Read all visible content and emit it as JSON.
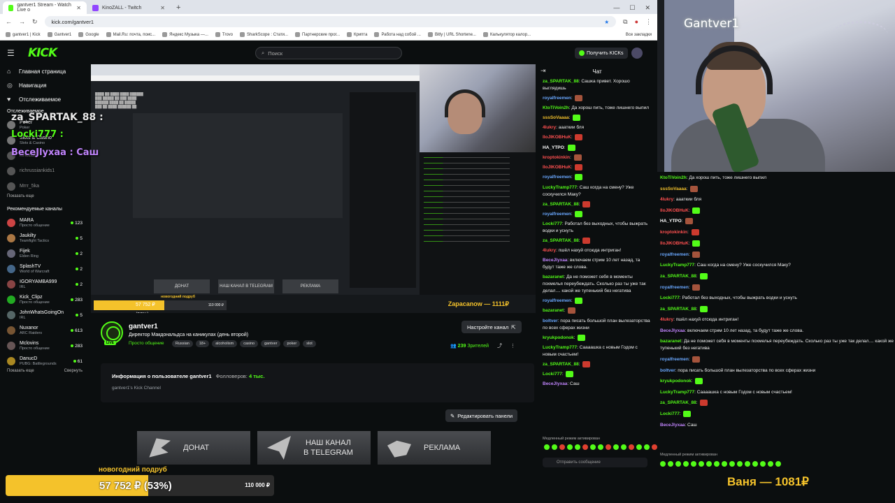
{
  "browser": {
    "tabs": [
      {
        "title": "gantver1 Stream - Watch Live o",
        "active": true,
        "color": "#53fc18"
      },
      {
        "title": "KinoZALL - Twitch",
        "active": false,
        "color": "#9146ff"
      }
    ],
    "url": "kick.com/gantver1",
    "bookmarks": [
      "gantver1 | Kick",
      "Gantver1",
      "Google",
      "Mail.Ru: почта, поис...",
      "Яндекс Музыка —...",
      "Trovo",
      "SharkScope : Стати...",
      "Партнерские прог...",
      "Крипта",
      "Работа над собой ...",
      "Bitly | URL Shortene...",
      "Калькулятор калор..."
    ],
    "all_bookmarks": "Все закладки"
  },
  "kick": {
    "logo": "KICK",
    "search_placeholder": "Поиск",
    "get_kicks": "Получить KICKs",
    "nav": {
      "home": "Главная страница",
      "browse": "Навигация",
      "following": "Отслеживаемое"
    },
    "following_title": "Отслеживаемое",
    "following": [
      {
        "name": "Poker",
        "game": "Poker",
        "dim": false
      },
      {
        "name": "Slots & Casino",
        "game": "Slots & Casino",
        "dim": false
      },
      {
        "name": "kinozall",
        "game": "",
        "dim": true
      },
      {
        "name": "richrussiankids1",
        "game": "",
        "dim": true
      },
      {
        "name": "Mrrr_5ka",
        "game": "",
        "dim": true
      }
    ],
    "show_more": "Показать еще",
    "recommended_title": "Рекомендуемые каналы",
    "recommended": [
      {
        "name": "MARA",
        "game": "Просто общение",
        "count": "123",
        "color": "#c44"
      },
      {
        "name": "Jaukilty",
        "game": "Teamfight Tactics",
        "count": "5",
        "color": "#a74"
      },
      {
        "name": "Fijek",
        "game": "Elden Ring",
        "count": "2",
        "color": "#667"
      },
      {
        "name": "SplashTV",
        "game": "World of Warcraft",
        "count": "2",
        "color": "#468"
      },
      {
        "name": "IGORYAMBA999",
        "game": "IRL",
        "count": "2",
        "color": "#844"
      },
      {
        "name": "Kick_Clipz",
        "game": "Просто общение",
        "count": "283",
        "color": "#2a2"
      },
      {
        "name": "JohnWhatsGoingOn",
        "game": "IRL",
        "count": "5",
        "color": "#566"
      },
      {
        "name": "Nuxanor",
        "game": "ARC Raiders",
        "count": "613",
        "color": "#753"
      },
      {
        "name": "Mclovins",
        "game": "Просто общение",
        "count": "283",
        "color": "#655"
      },
      {
        "name": "DanucD",
        "game": "PUBG: Battlegrounds",
        "count": "61",
        "color": "#a82"
      }
    ],
    "show_more_2": "Показать еще",
    "collapse": "Свернуть"
  },
  "overlay_names": [
    {
      "text": "za_SPARTAK_88 :",
      "color": "#ffffff"
    },
    {
      "text": "Locki777 :",
      "color": "#53fc18"
    },
    {
      "text": "BeceJlyxaa : Саш",
      "color": "#c084fc"
    }
  ],
  "video": {
    "sub_label": "новогодний подруб",
    "bar_text": "57 752 ₽ (53%)",
    "bar_max": "110 000 ₽",
    "top_donor": "Zapacanow — 1111₽",
    "panels": [
      "ДОНАТ",
      "НАШ КАНАЛ В TELEGRAM",
      "РЕКЛАМА"
    ]
  },
  "channel": {
    "name": "gantver1",
    "live": "LIVE",
    "title": "Директор Макдональдса на каникулах (день второй)",
    "category": "Просто общение",
    "tags": [
      "Russian",
      "18+",
      "alcoholism",
      "casino",
      "gantver",
      "poker",
      "slot"
    ],
    "customize": "Настройте канал",
    "viewers": "239",
    "viewers_label": "Зрителей"
  },
  "about": {
    "heading": "Информация о пользователе gantver1",
    "followers_label": "Фолловеров:",
    "followers": "4 тыс.",
    "desc": "gantver1's Kick Channel",
    "edit_panels": "Редактировать панели"
  },
  "panels": [
    {
      "label": "ДОНАТ",
      "pic": "wing"
    },
    {
      "label": "НАШ КАНАЛ\nВ TELEGRAM",
      "pic": "plane"
    },
    {
      "label": "РЕКЛАМА",
      "pic": "hand"
    }
  ],
  "chat": {
    "title": "Чат",
    "messages": [
      {
        "user": "za_SPARTAK_88",
        "color": "#53fc18",
        "text": "Сашка привет. Хорошо выглядишь"
      },
      {
        "user": "royalfreemen",
        "color": "#6aa8ff",
        "text": ""
      },
      {
        "user": "KtoTiVoin2h",
        "color": "#53fc18",
        "text": "Да хорош пить, тоже лишнего выпил"
      },
      {
        "user": "sssSoVaaaa",
        "color": "#f4c22b",
        "text": ""
      },
      {
        "user": "4lukry",
        "color": "#ff5050",
        "text": "аааткии бля"
      },
      {
        "user": "lloJIKOBHuK",
        "color": "#ff5050",
        "text": ""
      },
      {
        "user": "HA_YTPO",
        "color": "#ffffff",
        "text": ""
      },
      {
        "user": "kroptokinkin",
        "color": "#ff5050",
        "text": ""
      },
      {
        "user": "lloJIKOBHuK",
        "color": "#ff5050",
        "text": ""
      },
      {
        "user": "royalfreemen",
        "color": "#6aa8ff",
        "text": ""
      },
      {
        "user": "LuckyTramp777",
        "color": "#53fc18",
        "text": "Саш когда на смену? Уже соскучился Маку?"
      },
      {
        "user": "za_SPARTAK_88",
        "color": "#53fc18",
        "text": ""
      },
      {
        "user": "royalfreemen",
        "color": "#6aa8ff",
        "text": ""
      },
      {
        "user": "Locki777",
        "color": "#53fc18",
        "text": "Работал без выходных, чтобы выжрать водки и уснуть"
      },
      {
        "user": "za_SPARTAK_88",
        "color": "#53fc18",
        "text": ""
      },
      {
        "user": "4lukry",
        "color": "#ff5050",
        "text": "пшёл нахуй отсюда интриган!"
      },
      {
        "user": "BeceJlyxaa",
        "color": "#c084fc",
        "text": "включаем стрим 10 лет назад, та будут таже же слова."
      },
      {
        "user": "bazaranet",
        "color": "#53fc18",
        "text": "Да не поможет себя в моменты похмелья переубеждать. Сколько раз ты уже так делал.... какой же тупенький без негатива"
      },
      {
        "user": "royalfreemen",
        "color": "#6aa8ff",
        "text": ""
      },
      {
        "user": "bazaranet",
        "color": "#53fc18",
        "text": ""
      },
      {
        "user": "boltver",
        "color": "#6aa8ff",
        "text": "пора писать большой план вылезаторства по всех сферах жизни"
      },
      {
        "user": "kryukpodonok",
        "color": "#53fc18",
        "text": ""
      },
      {
        "user": "LuckyTramp777",
        "color": "#53fc18",
        "text": "Саааашка с новым Годом с новым счастьем!"
      },
      {
        "user": "za_SPARTAK_88",
        "color": "#53fc18",
        "text": ""
      },
      {
        "user": "Locki777",
        "color": "#53fc18",
        "text": ""
      },
      {
        "user": "BeceJlyxaa",
        "color": "#c084fc",
        "text": "Саш"
      }
    ],
    "slow_mode": "Медленный режим активирован",
    "input_placeholder": "Отправить сообщение"
  },
  "cam": {
    "label": "Gantver1"
  },
  "overlay_chat": [
    {
      "user": "KtoTiVoin2h",
      "color": "#53fc18",
      "text": "Да хорош пить, тоже лишнего выпил"
    },
    {
      "user": "sssSoVaaaa",
      "color": "#f4c22b",
      "text": ""
    },
    {
      "user": "4lukry",
      "color": "#ff5050",
      "text": "аааткии бля"
    },
    {
      "user": "lloJIKOBHuK",
      "color": "#ff5050",
      "text": ""
    },
    {
      "user": "HA_YTPO",
      "color": "#ffffff",
      "text": ""
    },
    {
      "user": "kroptokinkin",
      "color": "#ff5050",
      "text": ""
    },
    {
      "user": "lloJIKOBHuK",
      "color": "#ff5050",
      "text": ""
    },
    {
      "user": "royalfreemen",
      "color": "#6aa8ff",
      "text": ""
    },
    {
      "user": "LuckyTramp777",
      "color": "#53fc18",
      "text": "Саш когда на смену? Уже соскучился Маку?"
    },
    {
      "user": "za_SPARTAK_88",
      "color": "#53fc18",
      "text": ""
    },
    {
      "user": "royalfreemen",
      "color": "#6aa8ff",
      "text": ""
    },
    {
      "user": "Locki777",
      "color": "#53fc18",
      "text": "Работал без выходных, чтобы выжрать водки и уснуть"
    },
    {
      "user": "za_SPARTAK_88",
      "color": "#53fc18",
      "text": ""
    },
    {
      "user": "4lukry",
      "color": "#ff5050",
      "text": "пшёл нахуй отсюда интриган!"
    },
    {
      "user": "BeceJlyxaa",
      "color": "#c084fc",
      "text": "включаем стрим 10 лет назад, та будут таже же слова."
    },
    {
      "user": "bazaranet",
      "color": "#53fc18",
      "text": "Да не поможет себя в моменты похмелья переубеждать. Сколько раз ты уже так делал.... какой же тупенький без негатива"
    },
    {
      "user": "royalfreemen",
      "color": "#6aa8ff",
      "text": ""
    },
    {
      "user": "boltver",
      "color": "#6aa8ff",
      "text": "пора писать большой план вылезаторства по всех сферах жизни"
    },
    {
      "user": "kryukpodonok",
      "color": "#53fc18",
      "text": ""
    },
    {
      "user": "LuckyTramp777",
      "color": "#53fc18",
      "text": "Саааашка с новым Годом с новым счастьем!"
    },
    {
      "user": "za_SPARTAK_88",
      "color": "#53fc18",
      "text": ""
    },
    {
      "user": "Locki777",
      "color": "#53fc18",
      "text": ""
    },
    {
      "user": "BeceJlyxaa",
      "color": "#c084fc",
      "text": "Саш"
    }
  ],
  "overlay_slow": "Медленный режим активирован",
  "goal": {
    "caption": "новогодний подруб",
    "text": "57 752 ₽ (53%)",
    "max": "110 000 ₽",
    "progress": 0.53
  },
  "top_donor": "Ваня — 1081₽"
}
